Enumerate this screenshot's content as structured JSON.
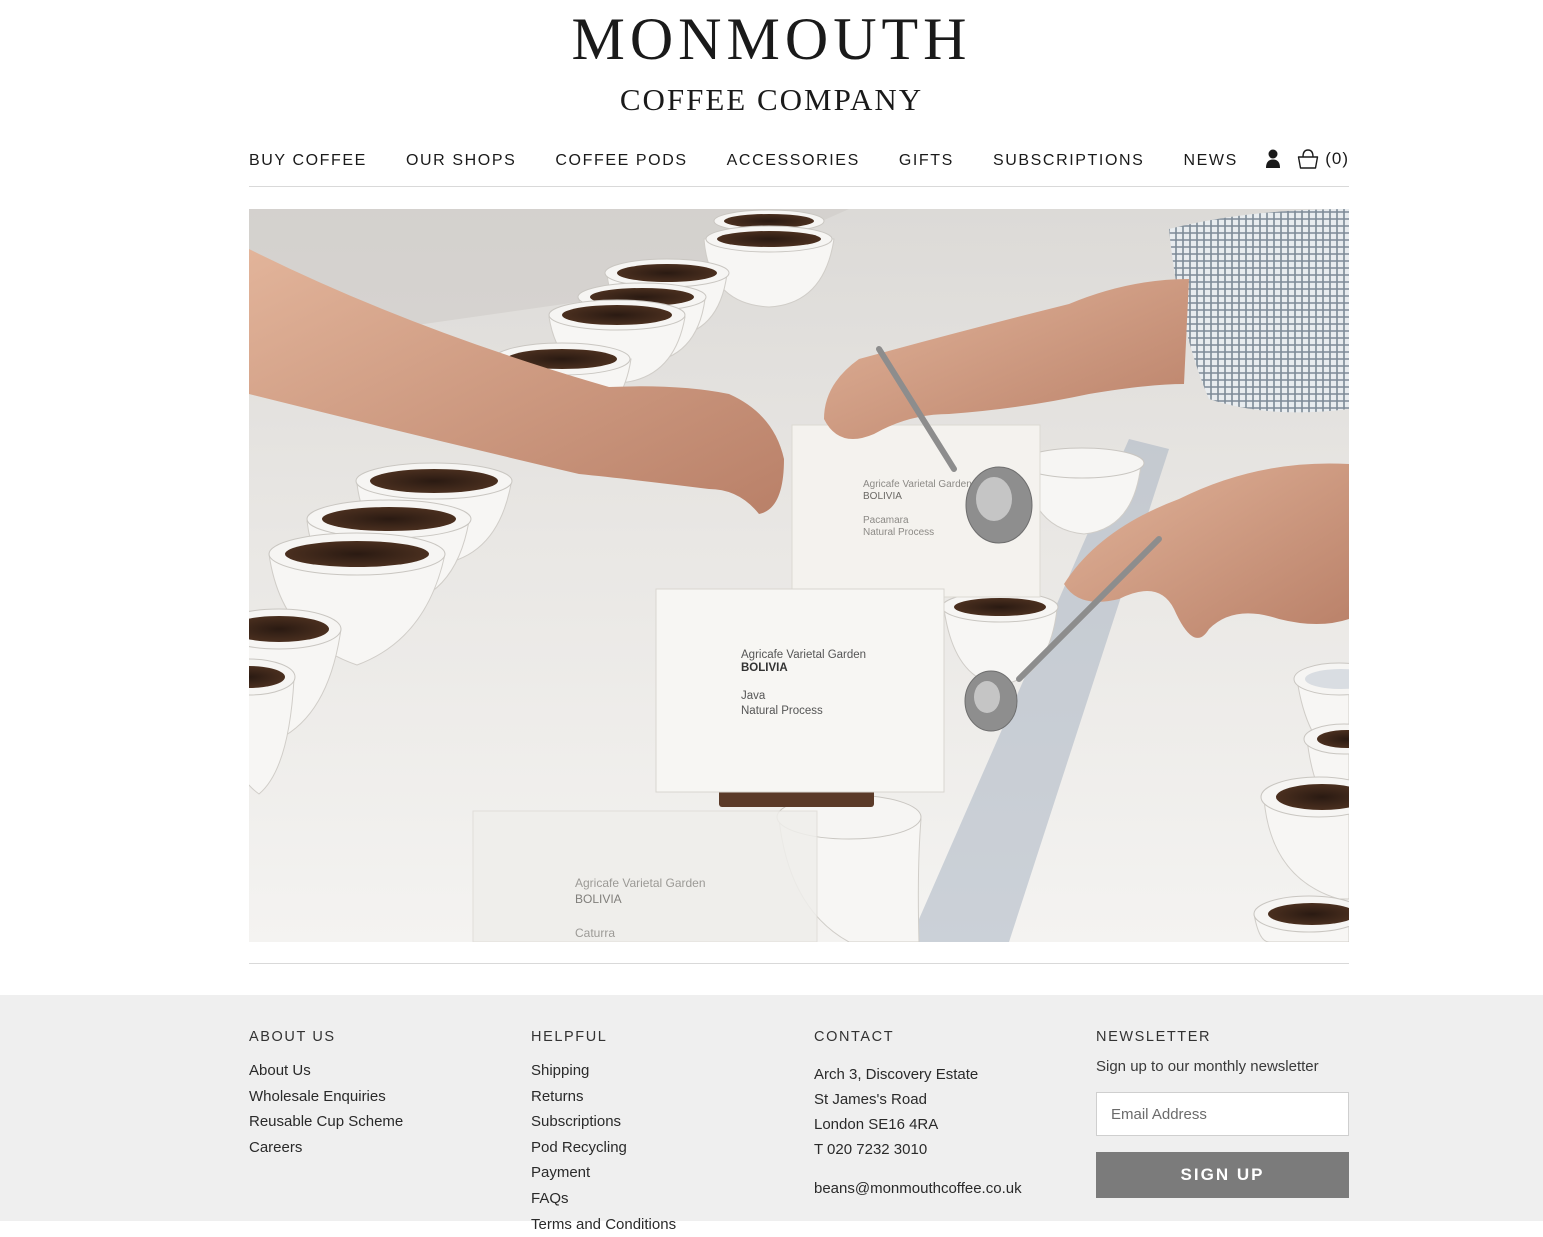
{
  "brand": {
    "name": "MONMOUTH",
    "subtitle": "COFFEE COMPANY"
  },
  "nav": {
    "items": [
      {
        "label": "BUY COFFEE"
      },
      {
        "label": "OUR SHOPS"
      },
      {
        "label": "COFFEE PODS"
      },
      {
        "label": "ACCESSORIES"
      },
      {
        "label": "GIFTS"
      },
      {
        "label": "SUBSCRIPTIONS"
      },
      {
        "label": "NEWS"
      }
    ],
    "account_icon": "user-icon",
    "basket_icon": "basket-icon",
    "cart_count": "(0)"
  },
  "hero": {
    "cards": [
      {
        "line1": "Agricafe Varietal Garden",
        "line2": "BOLIVIA",
        "line3": "Java",
        "line4": "Natural Process"
      },
      {
        "line1": "Agricafe Varietal Garden",
        "line2": "BOLIVIA",
        "line3": "Pacamara",
        "line4": "Natural Process"
      },
      {
        "line1": "Agricafe Varietal Garden",
        "line2": "BOLIVIA",
        "line3": "Caturra",
        "line4": ""
      }
    ]
  },
  "footer": {
    "about": {
      "heading": "ABOUT US",
      "links": [
        "About Us",
        "Wholesale Enquiries",
        "Reusable Cup Scheme",
        "Careers"
      ]
    },
    "helpful": {
      "heading": "HELPFUL",
      "links": [
        "Shipping",
        "Returns",
        "Subscriptions",
        "Pod Recycling",
        "Payment",
        "FAQs",
        "Terms and Conditions"
      ]
    },
    "contact": {
      "heading": "CONTACT",
      "lines": [
        "Arch 3, Discovery Estate",
        "St James's Road",
        "London SE16 4RA",
        "T 020 7232 3010"
      ],
      "email": "beans@monmouthcoffee.co.uk"
    },
    "newsletter": {
      "heading": "NEWSLETTER",
      "intro": "Sign up to our monthly newsletter",
      "placeholder": "Email Address",
      "button": "SIGN UP"
    }
  }
}
